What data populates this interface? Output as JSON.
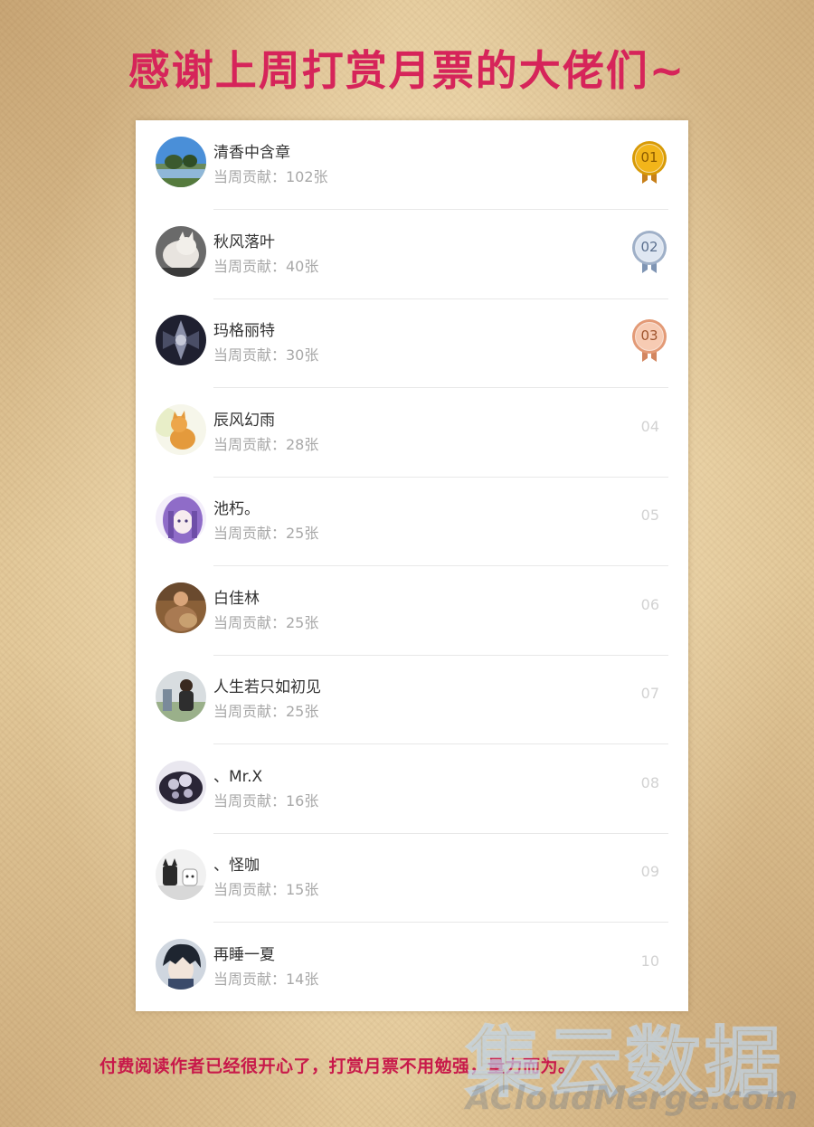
{
  "title": "感谢上周打赏月票的大佬们~",
  "contribution_prefix": "当周贡献：",
  "entries": [
    {
      "rank": "01",
      "name": "清香中含章",
      "contribution": "当周贡献：102张",
      "medal": "gold",
      "avatar": "lake-landscape"
    },
    {
      "rank": "02",
      "name": "秋风落叶",
      "contribution": "当周贡献：40张",
      "medal": "silver",
      "avatar": "white-cat"
    },
    {
      "rank": "03",
      "name": "玛格丽特",
      "contribution": "当周贡献：30张",
      "medal": "bronze",
      "avatar": "dark-emblem"
    },
    {
      "rank": "04",
      "name": "辰风幻雨",
      "contribution": "当周贡献：28张",
      "medal": "none",
      "avatar": "orange-cat"
    },
    {
      "rank": "05",
      "name": "池朽。",
      "contribution": "当周贡献：25张",
      "medal": "none",
      "avatar": "purple-anime"
    },
    {
      "rank": "06",
      "name": "白佳林",
      "contribution": "当周贡献：25张",
      "medal": "none",
      "avatar": "person-with-dog"
    },
    {
      "rank": "07",
      "name": "人生若只如初见",
      "contribution": "当周贡献：25张",
      "medal": "none",
      "avatar": "person-outdoors"
    },
    {
      "rank": "08",
      "name": "、Mr.X",
      "contribution": "当周贡献：16张",
      "medal": "none",
      "avatar": "flower-plate"
    },
    {
      "rank": "09",
      "name": "、怪咖",
      "contribution": "当周贡献：15张",
      "medal": "none",
      "avatar": "cartoon-figures"
    },
    {
      "rank": "10",
      "name": "再睡一夏",
      "contribution": "当周贡献：14张",
      "medal": "none",
      "avatar": "anime-boy"
    }
  ],
  "footer": "付费阅读作者已经很开心了，打赏月票不用勉强，量力而为。",
  "watermark": {
    "cjk": "集云数据",
    "latin": "ACloudMerge.com"
  },
  "colors": {
    "title": "#d6245a",
    "footer": "#c8194a",
    "gold": "#e5a50a",
    "silver": "#9fb0c8",
    "bronze": "#e9a27f"
  }
}
